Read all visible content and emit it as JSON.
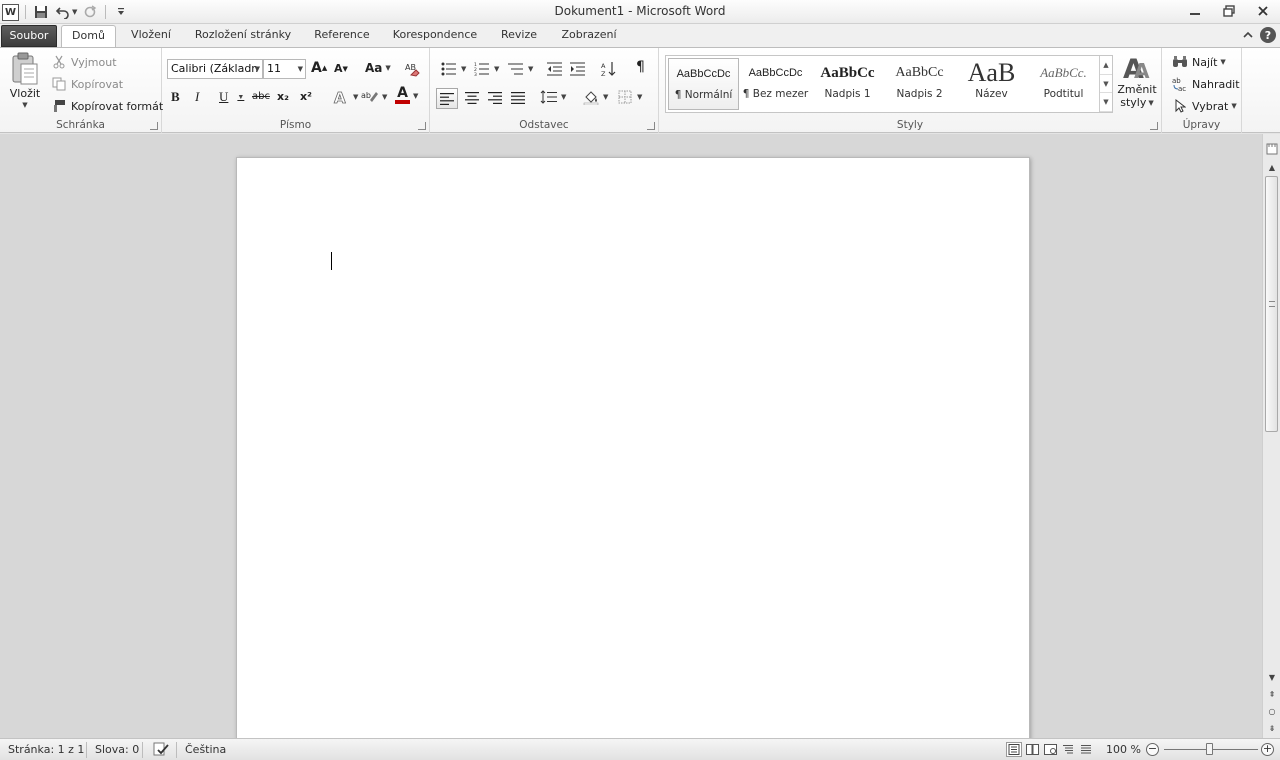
{
  "window": {
    "title": "Dokument1 - Microsoft Word"
  },
  "qat": {
    "word_icon": "W"
  },
  "tabs": [
    {
      "label": "Soubor"
    },
    {
      "label": "Domů"
    },
    {
      "label": "Vložení"
    },
    {
      "label": "Rozložení stránky"
    },
    {
      "label": "Reference"
    },
    {
      "label": "Korespondence"
    },
    {
      "label": "Revize"
    },
    {
      "label": "Zobrazení"
    }
  ],
  "clipboard": {
    "paste": "Vložit",
    "cut": "Vyjmout",
    "copy": "Kopírovat",
    "format_painter": "Kopírovat formát",
    "label": "Schránka"
  },
  "font": {
    "name": "Calibri (Základn",
    "size": "11",
    "grow": "A",
    "shrink": "A",
    "case": "Aa",
    "bold": "B",
    "italic": "I",
    "underline": "U",
    "strike": "abc",
    "sub": "x₂",
    "sup": "x²",
    "color_letter": "A",
    "label": "Písmo"
  },
  "paragraph": {
    "label": "Odstavec",
    "pilcrow": "¶",
    "sort": "A↓Z"
  },
  "styles": {
    "items": [
      {
        "sample": "AaBbCcDc",
        "label": "¶ Normální"
      },
      {
        "sample": "AaBbCcDc",
        "label": "¶ Bez mezer"
      },
      {
        "sample": "AaBbCc",
        "label": "Nadpis 1"
      },
      {
        "sample": "AaBbCc",
        "label": "Nadpis 2"
      },
      {
        "sample": "AaB",
        "label": "Název"
      },
      {
        "sample": "AaBbCc.",
        "label": "Podtitul"
      }
    ],
    "change_line1": "Změnit",
    "change_line2": "styly",
    "label": "Styly"
  },
  "editing": {
    "find": "Najít",
    "replace": "Nahradit",
    "select": "Vybrat",
    "label": "Úpravy"
  },
  "status": {
    "page": "Stránka: 1 z 1",
    "words": "Slova: 0",
    "language": "Čeština",
    "zoom": "100 %"
  },
  "colors": {
    "font_color": "#c00000",
    "highlight": "#ffff00",
    "file_tab": "#4a4a4a"
  },
  "icons": {
    "save": "save-icon",
    "undo": "undo-icon",
    "redo": "redo-icon",
    "customize": "chevron-down-icon",
    "minimize": "minimize-icon",
    "restore": "restore-icon",
    "close": "close-icon",
    "help": "help-icon",
    "collapse": "chevron-up-icon"
  }
}
